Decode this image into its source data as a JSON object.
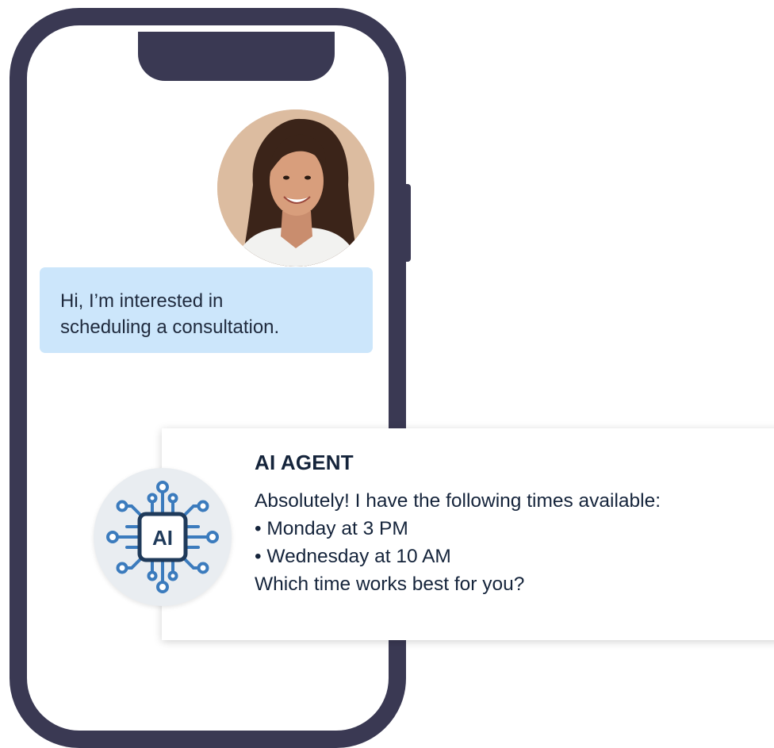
{
  "user_message": {
    "lines": [
      "Hi, I’m interested in",
      "scheduling a consultation."
    ]
  },
  "ai_message": {
    "sender": "AI AGENT",
    "icon_label": "AI",
    "icon": "ai-chip-icon",
    "lines": [
      "Absolutely! I have the following times available:",
      "• Monday at 3 PM",
      "• Wednesday at 10 AM",
      "Which time works best for you?"
    ]
  },
  "colors": {
    "phone_frame": "#3a3953",
    "user_bubble": "#cce6fb",
    "text_dark": "#15243b",
    "ai_accent": "#3b7bbd"
  }
}
